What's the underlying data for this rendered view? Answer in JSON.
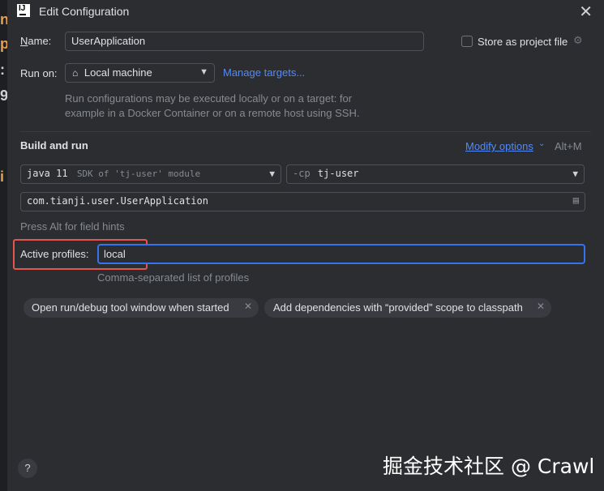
{
  "window": {
    "title": "Edit Configuration"
  },
  "form": {
    "name_label_prefix": "N",
    "name_label_rest": "ame:",
    "name_value": "UserApplication",
    "store_label": "Store as project file",
    "run_on_label": "Run on:",
    "run_on_value": "Local machine",
    "manage_targets": "Manage targets...",
    "run_on_hint_1": "Run configurations may be executed locally or on a target: for",
    "run_on_hint_2": "example in a Docker Container or on a remote host using SSH."
  },
  "build_and_run": {
    "section_title": "Build and run",
    "modify_options": "Modify options",
    "modify_shortcut": "Alt+M",
    "sdk_value": "java 11",
    "sdk_desc": "SDK of 'tj-user' module",
    "cp_prefix": "-cp",
    "cp_value": "tj-user",
    "main_class": "com.tianji.user.UserApplication",
    "field_hint": "Press Alt for field hints"
  },
  "profiles": {
    "label": "Active profiles:",
    "value": "local",
    "hint": "Comma-separated list of profiles"
  },
  "chips": [
    {
      "label": "Open run/debug tool window when started"
    },
    {
      "label": "Add dependencies with “provided” scope to classpath"
    }
  ],
  "footer": {
    "help": "?",
    "watermark": "掘金技术社区 @ Crawl"
  },
  "background_glyphs": [
    "n",
    "p",
    ":",
    "9",
    "i"
  ],
  "icons": [
    "intellij-icon",
    "close-icon",
    "gear-icon",
    "home-icon",
    "chevron-down-icon",
    "browse-icon",
    "remove-chip-icon",
    "help-icon"
  ],
  "colors": {
    "accent": "#3574f0",
    "link": "#548af7",
    "highlight": "#e4554f",
    "background": "#2b2d30"
  }
}
